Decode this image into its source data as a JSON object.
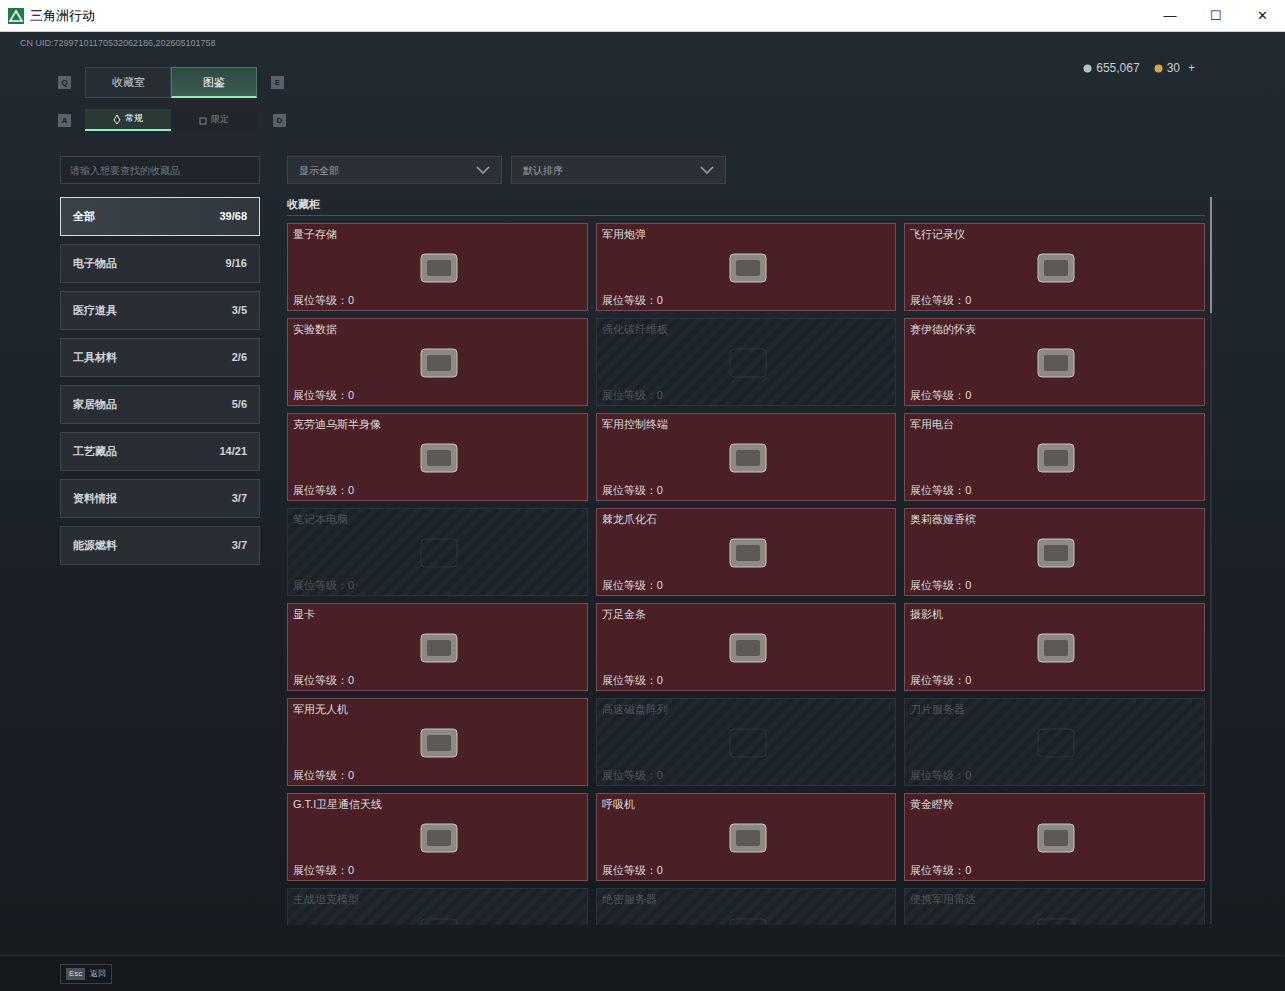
{
  "window": {
    "title": "三角洲行动",
    "controls": [
      "—",
      "☐",
      "✕"
    ]
  },
  "uid": "CN UID:72997101170532062186,202605101758",
  "currency": [
    {
      "amount": "655,067",
      "extra": ""
    },
    {
      "amount": "30",
      "extra": "+"
    }
  ],
  "tabs": {
    "prev_key": "Q",
    "next_key": "E",
    "items": [
      {
        "label": "收藏室",
        "selected": false
      },
      {
        "label": "图鉴",
        "selected": true
      }
    ]
  },
  "subtabs": {
    "prev_key": "A",
    "next_key": "D",
    "items": [
      {
        "label": "常规",
        "selected": true
      },
      {
        "label": "限定",
        "selected": false
      }
    ]
  },
  "search": {
    "placeholder": "请输入想要查找的收藏品"
  },
  "categories": [
    {
      "label": "全部",
      "count": "39/68",
      "selected": true
    },
    {
      "label": "电子物品",
      "count": "9/16",
      "selected": false
    },
    {
      "label": "医疗道具",
      "count": "3/5",
      "selected": false
    },
    {
      "label": "工具材料",
      "count": "2/6",
      "selected": false
    },
    {
      "label": "家居物品",
      "count": "5/6",
      "selected": false
    },
    {
      "label": "工艺藏品",
      "count": "14/21",
      "selected": false
    },
    {
      "label": "资料情报",
      "count": "3/7",
      "selected": false
    },
    {
      "label": "能源燃料",
      "count": "3/7",
      "selected": false
    }
  ],
  "filters": [
    {
      "value": "显示全部"
    },
    {
      "value": "默认排序"
    }
  ],
  "section_title": "收藏柜",
  "scrollbar": {
    "level": 0.16
  },
  "items": [
    {
      "name": "量子存储",
      "level_label": "展位等级：0",
      "unlocked": true
    },
    {
      "name": "军用炮弹",
      "level_label": "展位等级：0",
      "unlocked": true
    },
    {
      "name": "飞行记录仪",
      "level_label": "展位等级：0",
      "unlocked": true
    },
    {
      "name": "实验数据",
      "level_label": "展位等级：0",
      "unlocked": true
    },
    {
      "name": "强化碳纤维板",
      "level_label": "展位等级：0",
      "unlocked": false
    },
    {
      "name": "赛伊德的怀表",
      "level_label": "展位等级：0",
      "unlocked": true
    },
    {
      "name": "克劳迪乌斯半身像",
      "level_label": "展位等级：0",
      "unlocked": true
    },
    {
      "name": "军用控制终端",
      "level_label": "展位等级：0",
      "unlocked": true
    },
    {
      "name": "军用电台",
      "level_label": "展位等级：0",
      "unlocked": true
    },
    {
      "name": "笔记本电脑",
      "level_label": "展位等级：0",
      "unlocked": false
    },
    {
      "name": "棘龙爪化石",
      "level_label": "展位等级：0",
      "unlocked": true
    },
    {
      "name": "奥莉薇娅香槟",
      "level_label": "展位等级：0",
      "unlocked": true
    },
    {
      "name": "显卡",
      "level_label": "展位等级：0",
      "unlocked": true
    },
    {
      "name": "万足金条",
      "level_label": "展位等级：0",
      "unlocked": true
    },
    {
      "name": "摄影机",
      "level_label": "展位等级：0",
      "unlocked": true
    },
    {
      "name": "军用无人机",
      "level_label": "展位等级：0",
      "unlocked": true
    },
    {
      "name": "高速磁盘阵列",
      "level_label": "展位等级：0",
      "unlocked": false
    },
    {
      "name": "刀片服务器",
      "level_label": "展位等级：0",
      "unlocked": false
    },
    {
      "name": "G.T.I卫星通信天线",
      "level_label": "展位等级：0",
      "unlocked": true
    },
    {
      "name": "呼吸机",
      "level_label": "展位等级：0",
      "unlocked": true
    },
    {
      "name": "黄金瞪羚",
      "level_label": "展位等级：0",
      "unlocked": true
    },
    {
      "name": "主战坦克模型",
      "unlocked": false
    },
    {
      "name": "绝密服务器",
      "unlocked": false
    },
    {
      "name": "便携军用雷达",
      "unlocked": false
    }
  ],
  "footer": {
    "key": "Esc",
    "label": "返回"
  }
}
